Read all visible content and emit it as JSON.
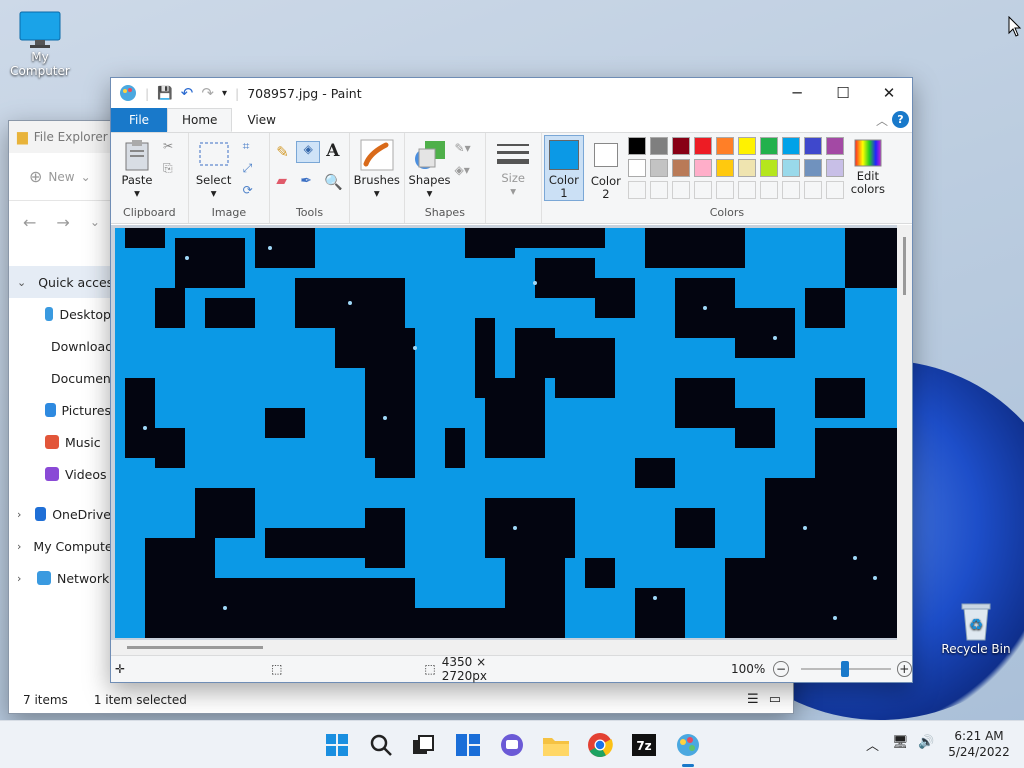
{
  "desktop": {
    "my_computer": "My Computer",
    "recycle_bin": "Recycle Bin"
  },
  "explorer": {
    "title": "File Explorer",
    "new_label": "New",
    "sidebar": [
      {
        "label": "Quick access",
        "icon": "star-icon",
        "chevron": "v"
      },
      {
        "label": "Desktop",
        "icon": "desktop-icon"
      },
      {
        "label": "Downloads",
        "icon": "download-icon"
      },
      {
        "label": "Documents",
        "icon": "document-icon"
      },
      {
        "label": "Pictures",
        "icon": "pictures-icon"
      },
      {
        "label": "Music",
        "icon": "music-icon"
      },
      {
        "label": "Videos",
        "icon": "videos-icon"
      },
      {
        "label": "OneDrive",
        "icon": "cloud-icon",
        "chevron": ">"
      },
      {
        "label": "My Computer",
        "icon": "computer-icon",
        "chevron": ">"
      },
      {
        "label": "Network",
        "icon": "network-icon",
        "chevron": ">"
      }
    ],
    "status_items": "7 items",
    "status_selected": "1 item selected"
  },
  "paint": {
    "title": "708957.jpg - Paint",
    "tabs": {
      "file": "File",
      "home": "Home",
      "view": "View"
    },
    "groups": {
      "clipboard": "Clipboard",
      "image": "Image",
      "tools": "Tools",
      "shapes": "Shapes",
      "colors": "Colors"
    },
    "buttons": {
      "paste": "Paste",
      "select": "Select",
      "brushes": "Brushes",
      "shapes": "Shapes",
      "size": "Size",
      "color1": "Color 1",
      "color2": "Color 2",
      "edit_colors": "Edit colors"
    },
    "palette_row1": [
      "#000000",
      "#7f7f7f",
      "#880015",
      "#ed1c24",
      "#ff7f27",
      "#fff200",
      "#22b14c",
      "#00a2e8",
      "#3f48cc",
      "#a349a4"
    ],
    "palette_row2": [
      "#ffffff",
      "#c3c3c3",
      "#b97a57",
      "#ffaec9",
      "#ffc90e",
      "#efe4b0",
      "#b5e61d",
      "#99d9ea",
      "#7092be",
      "#c8bfe7"
    ],
    "color1_value": "#0b99e6",
    "color2_value": "#ffffff",
    "status_dimensions": "4350 × 2720px",
    "zoom": "100%"
  },
  "taskbar": {
    "time": "6:21 AM",
    "date": "5/24/2022"
  }
}
